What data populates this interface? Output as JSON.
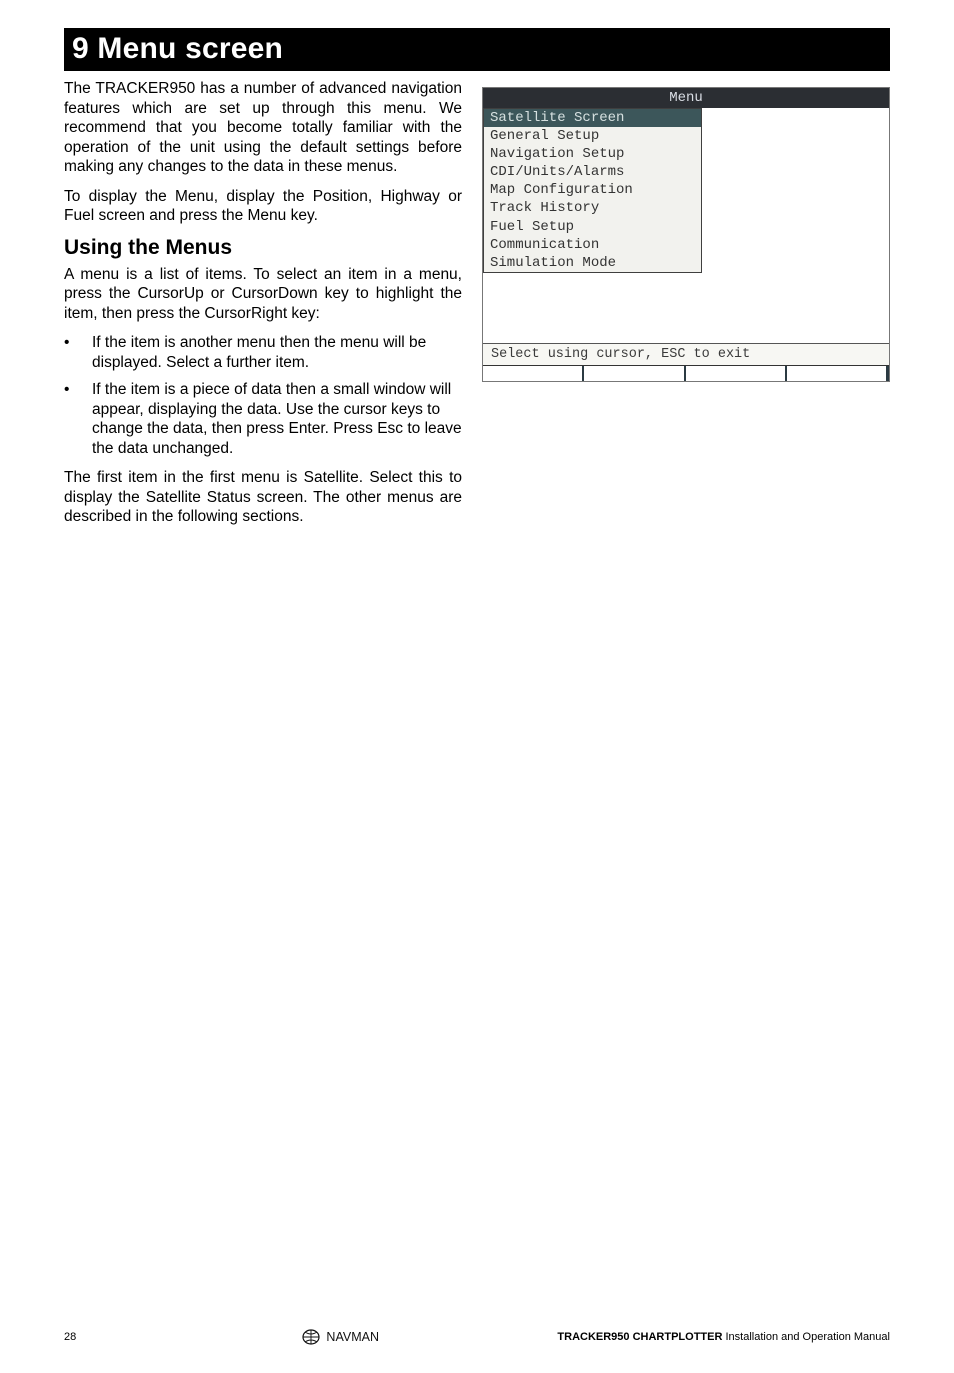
{
  "section": {
    "title": "9 Menu screen"
  },
  "left": {
    "p1": "The TRACKER950 has a number of advanced navigation features which are set up through this menu. We recommend that you become totally familiar with the operation of the unit using the default settings before making any changes to the data in these menus.",
    "p2": "To display the Menu, display the Position, Highway or Fuel screen and press the Menu key.",
    "subhead": "Using the Menus",
    "p3": "A menu is a list of items. To select an item in a menu, press the CursorUp or CursorDown key to highlight the item, then press the CursorRight key:",
    "bullets": [
      "If the item is another menu then the menu will be displayed. Select a further item.",
      "If the item is a piece of data then a small window will appear, displaying the data. Use the cursor keys to change the data, then press Enter. Press Esc to leave the data unchanged."
    ],
    "p4": "The first item in the first menu is Satellite. Select this to display the Satellite Status screen. The other menus are described in the following sections."
  },
  "menu": {
    "title": "Menu",
    "items": [
      "Satellite Screen",
      "General Setup",
      "Navigation Setup",
      "CDI/Units/Alarms",
      "Map Configuration",
      "Track History",
      "Fuel Setup",
      "Communication",
      "Simulation Mode"
    ],
    "footer": "Select using cursor, ESC to exit"
  },
  "footer": {
    "page_number": "28",
    "brand": "NAVMAN",
    "manual_bold": "TRACKER950 CHARTPLOTTER",
    "manual_rest": " Installation and Operation Manual"
  }
}
